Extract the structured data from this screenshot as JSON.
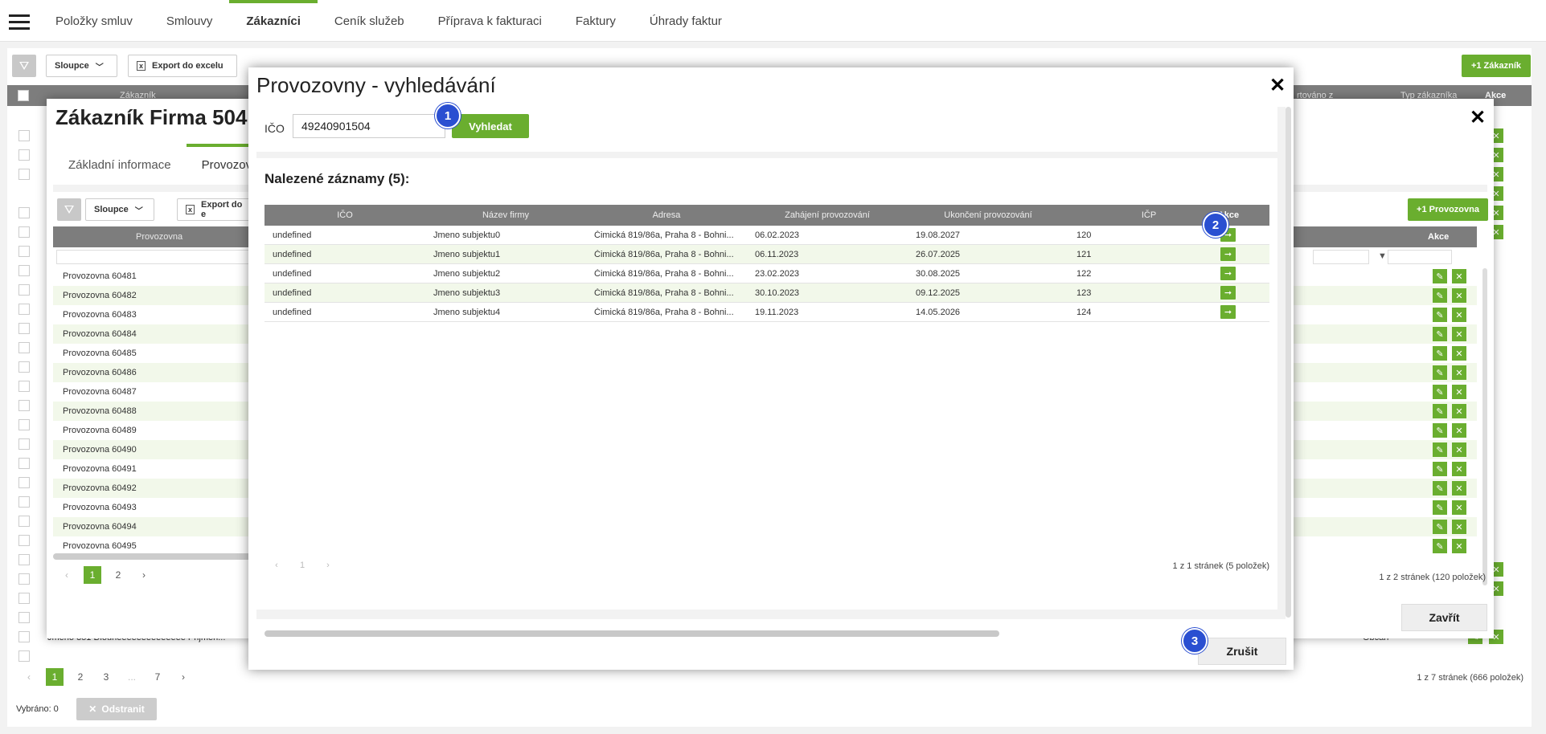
{
  "nav": {
    "tabs": [
      {
        "label": "Položky smluv"
      },
      {
        "label": "Smlouvy"
      },
      {
        "label": "Zákazníci"
      },
      {
        "label": "Ceník služeb"
      },
      {
        "label": "Příprava k fakturaci"
      },
      {
        "label": "Faktury"
      },
      {
        "label": "Úhrady faktur"
      }
    ],
    "active_tab": "Zákazníci"
  },
  "base": {
    "columns_label": "Sloupce",
    "export_label": "Export do excelu",
    "add_label": "+1 Zákazník",
    "header": {
      "customer": "Zákazník",
      "sorted_from": "rtováno z",
      "customer_type": "Typ zákazníka",
      "actions": "Akce"
    },
    "visible_row": {
      "name": "Jmeno 351 Dlouheeeeeeeeeeeeee Prijmen...",
      "type": "Občan"
    },
    "pager": {
      "pages": [
        "1",
        "2",
        "3",
        "...",
        "7"
      ],
      "summary": "1 z 7 stránek (666 položek)"
    },
    "selected_label": "Vybráno: 0",
    "remove_label": "Odstranit"
  },
  "customer_modal": {
    "title": "Zákazník Firma 504",
    "tabs": [
      "Základní informace",
      "Provozovny"
    ],
    "columns_label": "Sloupce",
    "export_label": "Export do e",
    "add_label": "+1 Provozovna",
    "header": {
      "branch": "Provozovna",
      "actions": "Akce"
    },
    "rows": [
      "Provozovna 60481",
      "Provozovna 60482",
      "Provozovna 60483",
      "Provozovna 60484",
      "Provozovna 60485",
      "Provozovna 60486",
      "Provozovna 60487",
      "Provozovna 60488",
      "Provozovna 60489",
      "Provozovna 60490",
      "Provozovna 60491",
      "Provozovna 60492",
      "Provozovna 60493",
      "Provozovna 60494",
      "Provozovna 60495"
    ],
    "pager": {
      "pages": [
        "1",
        "2"
      ],
      "summary": "1 z 2 stránek (120 položek)"
    },
    "close_label": "Zavřít"
  },
  "search_modal": {
    "title": "Provozovny - vyhledávání",
    "ico_label": "IČO",
    "ico_value": "49240901504",
    "search_label": "Vyhledat",
    "results_title": "Nalezené záznamy (5):",
    "columns": [
      "IČO",
      "Název firmy",
      "Adresa",
      "Zahájení provozování",
      "Ukončení provozování",
      "IČP",
      "Akce"
    ],
    "rows": [
      {
        "ico": "undefined",
        "name": "Jmeno subjektu0",
        "address": "Čimická 819/86a, Praha 8 - Bohni...",
        "start": "06.02.2023",
        "end": "19.08.2027",
        "icp": "120"
      },
      {
        "ico": "undefined",
        "name": "Jmeno subjektu1",
        "address": "Čimická 819/86a, Praha 8 - Bohni...",
        "start": "06.11.2023",
        "end": "26.07.2025",
        "icp": "121"
      },
      {
        "ico": "undefined",
        "name": "Jmeno subjektu2",
        "address": "Čimická 819/86a, Praha 8 - Bohni...",
        "start": "23.02.2023",
        "end": "30.08.2025",
        "icp": "122"
      },
      {
        "ico": "undefined",
        "name": "Jmeno subjektu3",
        "address": "Čimická 819/86a, Praha 8 - Bohni...",
        "start": "30.10.2023",
        "end": "09.12.2025",
        "icp": "123"
      },
      {
        "ico": "undefined",
        "name": "Jmeno subjektu4",
        "address": "Čimická 819/86a, Praha 8 - Bohni...",
        "start": "19.11.2023",
        "end": "14.05.2026",
        "icp": "124"
      }
    ],
    "pager": {
      "page": "1",
      "summary": "1 z 1 stránek (5 položek)"
    },
    "cancel_label": "Zrušit"
  },
  "markers": [
    "1",
    "2",
    "3"
  ],
  "colors": {
    "accent": "#6aae2f",
    "header": "#7d7d7d",
    "marker": "#2a4fd1"
  }
}
